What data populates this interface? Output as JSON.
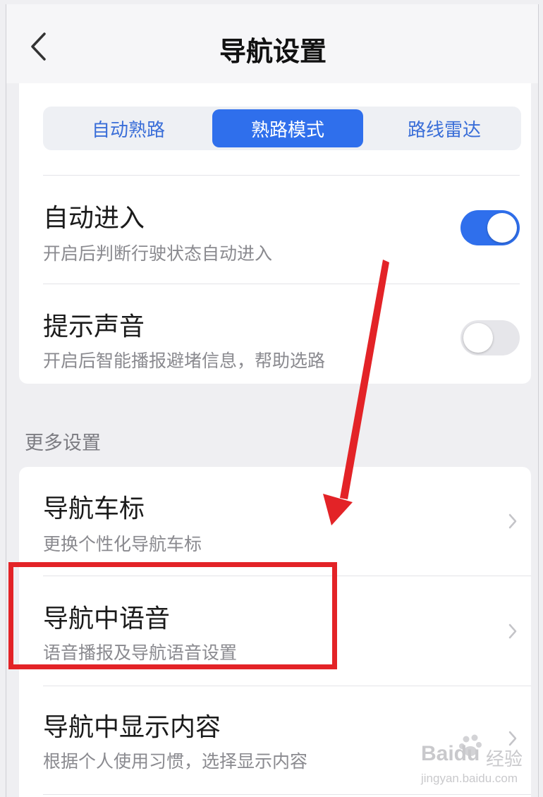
{
  "header": {
    "title": "导航设置",
    "back_icon": "chevron-left-icon"
  },
  "mode_switch": {
    "options": [
      "自动熟路",
      "熟路模式",
      "路线雷达"
    ],
    "selected": "熟路模式"
  },
  "settings": [
    {
      "title": "自动进入",
      "subtitle": "开启后判断行驶状态自动进入",
      "enabled": true
    },
    {
      "title": "提示声音",
      "subtitle": "开启后智能播报避堵信息，帮助选路",
      "enabled": false
    }
  ],
  "more_settings": {
    "label": "更多设置",
    "items": [
      {
        "title": "导航车标",
        "subtitle": "更换个性化导航车标",
        "icon": "chevron-right-icon"
      },
      {
        "title": "导航中语音",
        "subtitle": "语音播报及导航语音设置",
        "icon": "chevron-right-icon"
      },
      {
        "title": "导航中显示内容",
        "subtitle": "根据个人使用习惯，选择显示内容",
        "icon": "chevron-right-icon"
      }
    ]
  },
  "annotations": {
    "highlight_color": "#e32327",
    "arrow_color": "#e32327"
  },
  "watermark": {
    "brand": "Baidu",
    "suffix": "经验",
    "url": "jingyan.baidu.com"
  },
  "colors": {
    "accent": "#2f6fec",
    "background": "#efeff2"
  }
}
